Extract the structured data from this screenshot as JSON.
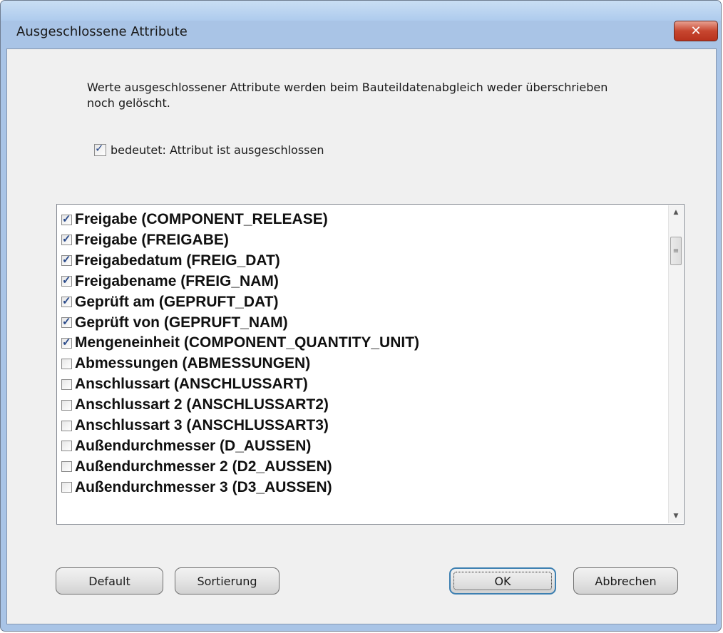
{
  "window": {
    "title": "Ausgeschlossene Attribute",
    "close_glyph": "✕"
  },
  "description": "Werte ausgeschlossener Attribute werden beim Bauteildatenabgleich weder überschrieben noch gelöscht.",
  "legend": {
    "label": "bedeutet:  Attribut ist ausgeschlossen",
    "checked": true
  },
  "attributes": [
    {
      "label": "Freigabe (COMPONENT_RELEASE)",
      "checked": true
    },
    {
      "label": "Freigabe (FREIGABE)",
      "checked": true
    },
    {
      "label": "Freigabedatum (FREIG_DAT)",
      "checked": true
    },
    {
      "label": "Freigabename (FREIG_NAM)",
      "checked": true
    },
    {
      "label": "Geprüft am (GEPRUFT_DAT)",
      "checked": true
    },
    {
      "label": "Geprüft von (GEPRUFT_NAM)",
      "checked": true
    },
    {
      "label": "Mengeneinheit (COMPONENT_QUANTITY_UNIT)",
      "checked": true
    },
    {
      "label": "Abmessungen (ABMESSUNGEN)",
      "checked": false
    },
    {
      "label": "Anschlussart (ANSCHLUSSART)",
      "checked": false
    },
    {
      "label": "Anschlussart 2 (ANSCHLUSSART2)",
      "checked": false
    },
    {
      "label": "Anschlussart 3 (ANSCHLUSSART3)",
      "checked": false
    },
    {
      "label": "Außendurchmesser (D_AUSSEN)",
      "checked": false
    },
    {
      "label": "Außendurchmesser 2 (D2_AUSSEN)",
      "checked": false
    },
    {
      "label": "Außendurchmesser 3 (D3_AUSSEN)",
      "checked": false
    }
  ],
  "buttons": {
    "default": "Default",
    "sort": "Sortierung",
    "ok": "OK",
    "cancel": "Abbrechen"
  },
  "colors": {
    "frame": "#a9c4e6",
    "client": "#f0f0f0",
    "close_button": "#c7462f",
    "default_button_border": "#3c7fb1"
  }
}
